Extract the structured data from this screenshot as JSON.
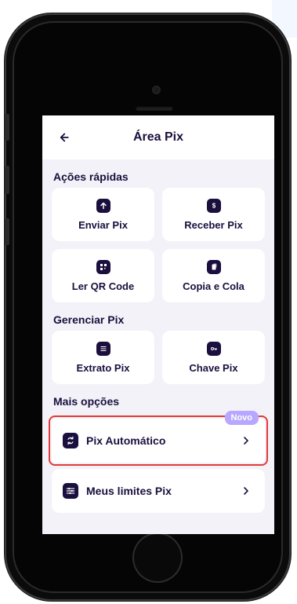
{
  "header": {
    "title": "Área Pix"
  },
  "sections": {
    "quick": {
      "label": "Ações rápidas",
      "items": [
        {
          "label": "Enviar Pix",
          "icon": "arrow-up-icon"
        },
        {
          "label": "Receber Pix",
          "icon": "dollar-icon"
        },
        {
          "label": "Ler QR Code",
          "icon": "qr-icon"
        },
        {
          "label": "Copia e Cola",
          "icon": "copy-icon"
        }
      ]
    },
    "manage": {
      "label": "Gerenciar Pix",
      "items": [
        {
          "label": "Extrato Pix",
          "icon": "list-icon"
        },
        {
          "label": "Chave Pix",
          "icon": "key-icon"
        }
      ]
    },
    "more": {
      "label": "Mais opções",
      "items": [
        {
          "label": "Pix Automático",
          "badge": "Novo",
          "icon": "refresh-icon"
        },
        {
          "label": "Meus limites Pix",
          "icon": "sliders-icon"
        }
      ]
    }
  },
  "colors": {
    "primary": "#1a0f3d",
    "badge": "#b7a7ff",
    "highlight": "#e23b3b"
  }
}
